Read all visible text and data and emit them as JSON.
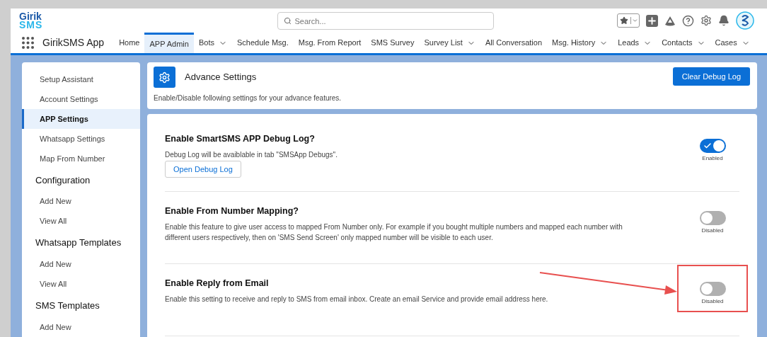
{
  "logo": {
    "line1": "Girik",
    "line2": "SMS"
  },
  "search": {
    "placeholder": "Search..."
  },
  "app_name": "GirikSMS App",
  "nav": [
    {
      "label": "Home",
      "selected": false,
      "dropdown": false
    },
    {
      "label": "APP Admin",
      "selected": true,
      "dropdown": false
    },
    {
      "label": "Bots",
      "selected": false,
      "dropdown": true
    },
    {
      "label": "Schedule Msg.",
      "selected": false,
      "dropdown": false
    },
    {
      "label": "Msg. From Report",
      "selected": false,
      "dropdown": false
    },
    {
      "label": "SMS Survey",
      "selected": false,
      "dropdown": false
    },
    {
      "label": "Survey List",
      "selected": false,
      "dropdown": true
    },
    {
      "label": "All Conversation",
      "selected": false,
      "dropdown": false
    },
    {
      "label": "Msg. History",
      "selected": false,
      "dropdown": true
    },
    {
      "label": "Leads",
      "selected": false,
      "dropdown": true
    },
    {
      "label": "Contacts",
      "selected": false,
      "dropdown": true
    },
    {
      "label": "Cases",
      "selected": false,
      "dropdown": true
    }
  ],
  "sidebar": {
    "items": [
      {
        "kind": "link",
        "label": "Setup Assistant",
        "selected": false
      },
      {
        "kind": "link",
        "label": "Account Settings",
        "selected": false
      },
      {
        "kind": "link",
        "label": "APP Settings",
        "selected": true
      },
      {
        "kind": "link",
        "label": "Whatsapp Settings",
        "selected": false
      },
      {
        "kind": "link",
        "label": "Map From Number",
        "selected": false
      },
      {
        "kind": "heading",
        "label": "Configuration"
      },
      {
        "kind": "link",
        "label": "Add New",
        "selected": false
      },
      {
        "kind": "link",
        "label": "View All",
        "selected": false
      },
      {
        "kind": "heading",
        "label": "Whatsapp Templates"
      },
      {
        "kind": "link",
        "label": "Add New",
        "selected": false
      },
      {
        "kind": "link",
        "label": "View All",
        "selected": false
      },
      {
        "kind": "heading",
        "label": "SMS Templates"
      },
      {
        "kind": "link",
        "label": "Add New",
        "selected": false
      }
    ]
  },
  "header": {
    "title": "Advance Settings",
    "subtitle": "Enable/Disable following settings for your advance features.",
    "button": "Clear Debug Log"
  },
  "settings": [
    {
      "title": "Enable SmartSMS APP Debug Log?",
      "description": "Debug Log will be avaiblable in tab \"SMSApp Debugs\".",
      "button": "Open Debug Log",
      "on": true,
      "status": "Enabled",
      "highlighted": false
    },
    {
      "title": "Enable From Number Mapping?",
      "description": "Enable this feature to give user access to mapped From Number only. For example if you bought multiple numbers and mapped each number with different users respectively, then on 'SMS Send Screen' only mapped number will be visible to each user.",
      "on": false,
      "status": "Disabled",
      "highlighted": false
    },
    {
      "title": "Enable Reply from Email",
      "description": "Enable this setting to receive and reply to SMS from email inbox. Create an email Service and provide email address here.",
      "on": false,
      "status": "Disabled",
      "highlighted": true
    }
  ]
}
